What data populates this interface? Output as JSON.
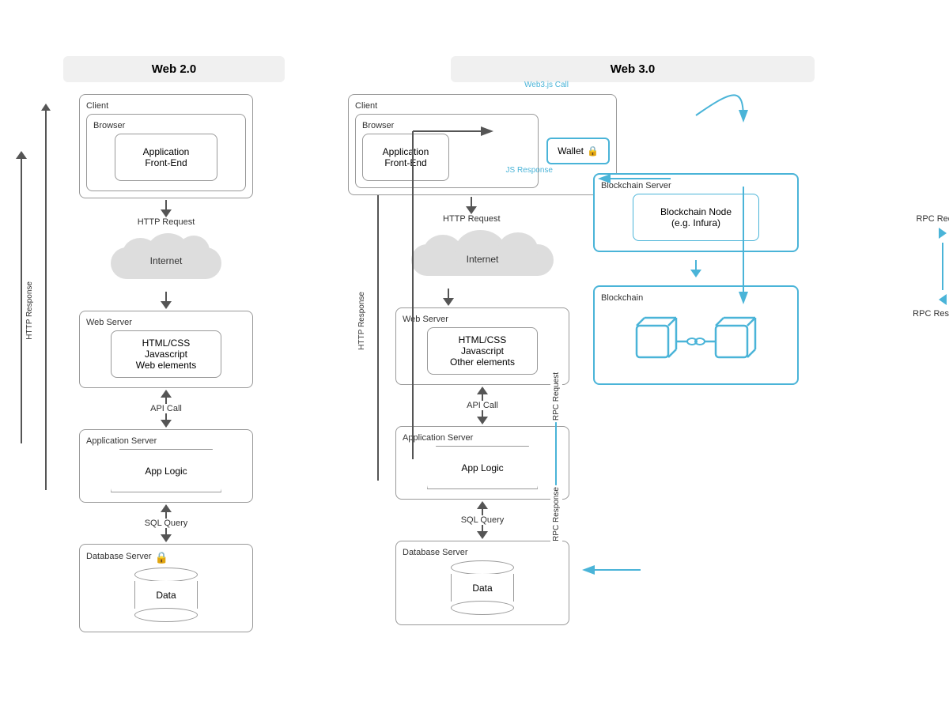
{
  "web2": {
    "title": "Web 2.0",
    "client_label": "Client",
    "browser_label": "Browser",
    "frontend_label": "Application\nFront-End",
    "http_request": "HTTP Request",
    "http_response": "HTTP Response",
    "internet_label": "Internet",
    "webserver_label": "Web Server",
    "webserver_content": "HTML/CSS\nJavascript\nWeb elements",
    "api_call": "API Call",
    "appserver_label": "Application Server",
    "applogic_label": "App Logic",
    "sql_query": "SQL Query",
    "dbserver_label": "Database Server",
    "data_label": "Data"
  },
  "web3": {
    "title": "Web 3.0",
    "client_label": "Client",
    "browser_label": "Browser",
    "frontend_label": "Application\nFront-End",
    "wallet_label": "Wallet",
    "web3js_call": "Web3.js Call",
    "js_response": "JS Response",
    "http_request": "HTTP Request",
    "http_response": "HTTP Response",
    "rpc_request_right": "RPC Request",
    "rpc_response_right": "RPC Response",
    "internet_label": "Internet",
    "webserver_label": "Web Server",
    "webserver_content": "HTML/CSS\nJavascript\nOther elements",
    "api_call": "API Call",
    "appserver_label": "Application Server",
    "applogic_label": "App Logic",
    "sql_query": "SQL Query",
    "dbserver_label": "Database Server",
    "data_label": "Data",
    "blockchain_server_label": "Blockchain Server",
    "blockchain_node_label": "Blockchain Node\n(e.g. Infura)",
    "blockchain_label": "Blockchain",
    "rpc_request_mid": "RPC Request",
    "rpc_response_mid": "RPC Response"
  },
  "colors": {
    "blue": "#4ab4d8",
    "gray": "#999",
    "dark": "#333"
  }
}
